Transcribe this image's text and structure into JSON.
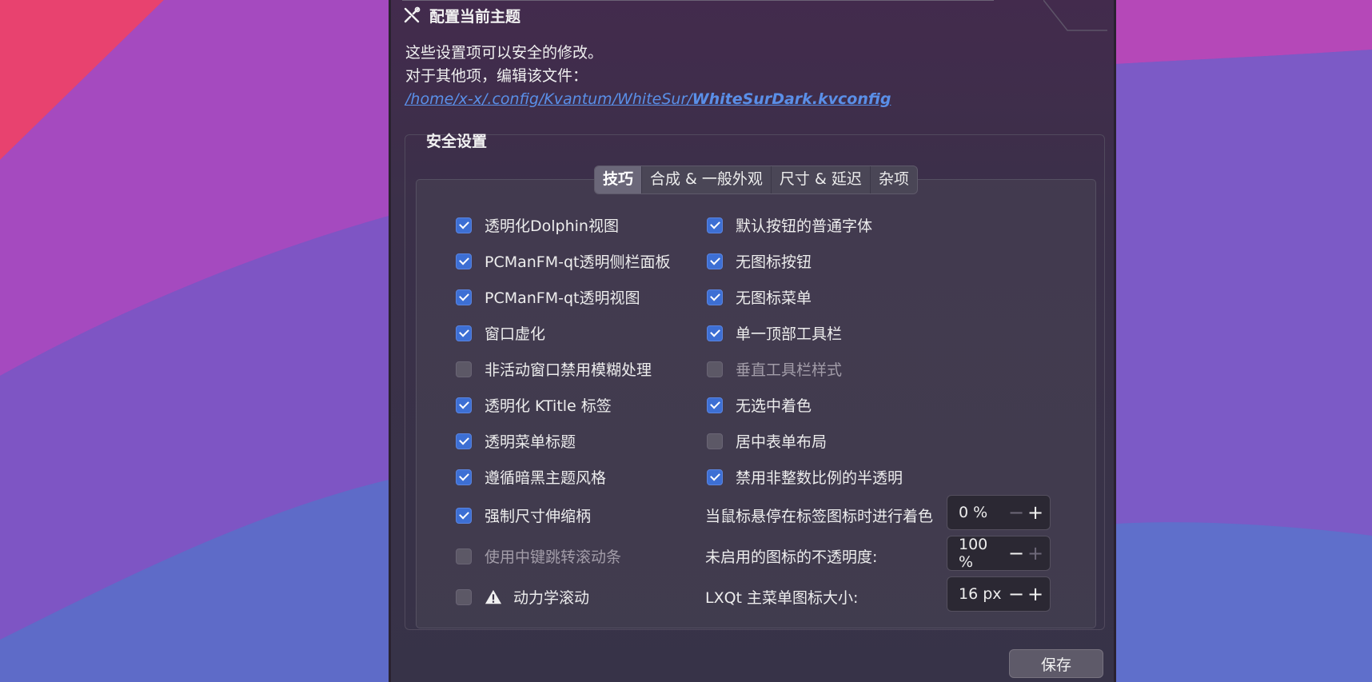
{
  "window": {
    "title": "配置当前主题"
  },
  "info": {
    "line1": "这些设置项可以安全的修改。",
    "line2": "对于其他项，编辑该文件：",
    "path_dir": "/home/x-x/.config/Kvantum/WhiteSur/",
    "path_file": "WhiteSurDark.kvconfig"
  },
  "group": {
    "title": "安全设置"
  },
  "tabs": [
    {
      "label": "技巧",
      "active": true
    },
    {
      "label": "合成 & 一般外观",
      "active": false
    },
    {
      "label": "尺寸 & 延迟",
      "active": false
    },
    {
      "label": "杂项",
      "active": false
    }
  ],
  "left_options": [
    {
      "label": "透明化Dolphin视图",
      "checked": true,
      "enabled": true
    },
    {
      "label": "PCManFM-qt透明侧栏面板",
      "checked": true,
      "enabled": true
    },
    {
      "label": "PCManFM-qt透明视图",
      "checked": true,
      "enabled": true
    },
    {
      "label": "窗口虚化",
      "checked": true,
      "enabled": true
    },
    {
      "label": "非活动窗口禁用模糊处理",
      "checked": false,
      "enabled": true
    },
    {
      "label": "透明化 KTitle 标签",
      "checked": true,
      "enabled": true
    },
    {
      "label": "透明菜单标题",
      "checked": true,
      "enabled": true
    },
    {
      "label": "遵循暗黑主题风格",
      "checked": true,
      "enabled": true
    },
    {
      "label": "强制尺寸伸缩柄",
      "checked": true,
      "enabled": true
    },
    {
      "label": "使用中键跳转滚动条",
      "checked": false,
      "enabled": false
    },
    {
      "label": "动力学滚动",
      "checked": false,
      "enabled": true,
      "warning_icon": "warning-triangle-icon"
    }
  ],
  "right_options": [
    {
      "label": "默认按钮的普通字体",
      "checked": true,
      "enabled": true
    },
    {
      "label": "无图标按钮",
      "checked": true,
      "enabled": true
    },
    {
      "label": "无图标菜单",
      "checked": true,
      "enabled": true
    },
    {
      "label": "单一顶部工具栏",
      "checked": true,
      "enabled": true
    },
    {
      "label": "垂直工具栏样式",
      "checked": false,
      "enabled": false
    },
    {
      "label": "无选中着色",
      "checked": true,
      "enabled": true
    },
    {
      "label": "居中表单布局",
      "checked": false,
      "enabled": true
    },
    {
      "label": "禁用非整数比例的半透明",
      "checked": true,
      "enabled": true
    }
  ],
  "spinners": [
    {
      "label": "当鼠标悬停在标签图标时进行着色",
      "value": "0 %",
      "minus_enabled": false,
      "plus_enabled": true
    },
    {
      "label": "未启用的图标的不透明度:",
      "value": "100 %",
      "minus_enabled": true,
      "plus_enabled": false
    },
    {
      "label": "LXQt 主菜单图标大小:",
      "value": "16 px",
      "minus_enabled": true,
      "plus_enabled": true
    }
  ],
  "footer": {
    "save_label": "保存"
  },
  "icons": {
    "title_icon": "tools-icon"
  },
  "colors": {
    "accent": "#3d6fd4",
    "link": "#5a8fe8"
  }
}
